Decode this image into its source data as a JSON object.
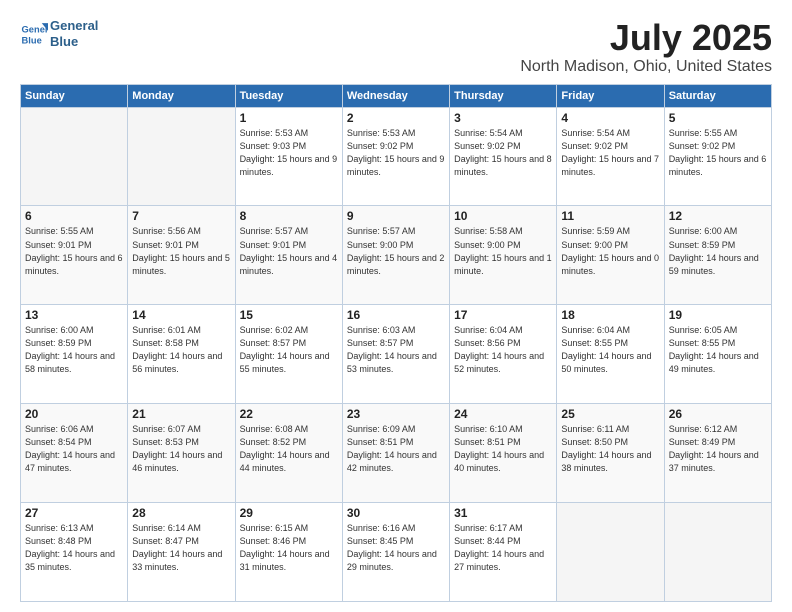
{
  "header": {
    "logo_line1": "General",
    "logo_line2": "Blue",
    "title": "July 2025",
    "subtitle": "North Madison, Ohio, United States"
  },
  "calendar": {
    "days_of_week": [
      "Sunday",
      "Monday",
      "Tuesday",
      "Wednesday",
      "Thursday",
      "Friday",
      "Saturday"
    ],
    "weeks": [
      [
        {
          "num": "",
          "info": "",
          "empty": true
        },
        {
          "num": "",
          "info": "",
          "empty": true
        },
        {
          "num": "1",
          "info": "Sunrise: 5:53 AM\nSunset: 9:03 PM\nDaylight: 15 hours and 9 minutes."
        },
        {
          "num": "2",
          "info": "Sunrise: 5:53 AM\nSunset: 9:02 PM\nDaylight: 15 hours and 9 minutes."
        },
        {
          "num": "3",
          "info": "Sunrise: 5:54 AM\nSunset: 9:02 PM\nDaylight: 15 hours and 8 minutes."
        },
        {
          "num": "4",
          "info": "Sunrise: 5:54 AM\nSunset: 9:02 PM\nDaylight: 15 hours and 7 minutes."
        },
        {
          "num": "5",
          "info": "Sunrise: 5:55 AM\nSunset: 9:02 PM\nDaylight: 15 hours and 6 minutes."
        }
      ],
      [
        {
          "num": "6",
          "info": "Sunrise: 5:55 AM\nSunset: 9:01 PM\nDaylight: 15 hours and 6 minutes."
        },
        {
          "num": "7",
          "info": "Sunrise: 5:56 AM\nSunset: 9:01 PM\nDaylight: 15 hours and 5 minutes."
        },
        {
          "num": "8",
          "info": "Sunrise: 5:57 AM\nSunset: 9:01 PM\nDaylight: 15 hours and 4 minutes."
        },
        {
          "num": "9",
          "info": "Sunrise: 5:57 AM\nSunset: 9:00 PM\nDaylight: 15 hours and 2 minutes."
        },
        {
          "num": "10",
          "info": "Sunrise: 5:58 AM\nSunset: 9:00 PM\nDaylight: 15 hours and 1 minute."
        },
        {
          "num": "11",
          "info": "Sunrise: 5:59 AM\nSunset: 9:00 PM\nDaylight: 15 hours and 0 minutes."
        },
        {
          "num": "12",
          "info": "Sunrise: 6:00 AM\nSunset: 8:59 PM\nDaylight: 14 hours and 59 minutes."
        }
      ],
      [
        {
          "num": "13",
          "info": "Sunrise: 6:00 AM\nSunset: 8:59 PM\nDaylight: 14 hours and 58 minutes."
        },
        {
          "num": "14",
          "info": "Sunrise: 6:01 AM\nSunset: 8:58 PM\nDaylight: 14 hours and 56 minutes."
        },
        {
          "num": "15",
          "info": "Sunrise: 6:02 AM\nSunset: 8:57 PM\nDaylight: 14 hours and 55 minutes."
        },
        {
          "num": "16",
          "info": "Sunrise: 6:03 AM\nSunset: 8:57 PM\nDaylight: 14 hours and 53 minutes."
        },
        {
          "num": "17",
          "info": "Sunrise: 6:04 AM\nSunset: 8:56 PM\nDaylight: 14 hours and 52 minutes."
        },
        {
          "num": "18",
          "info": "Sunrise: 6:04 AM\nSunset: 8:55 PM\nDaylight: 14 hours and 50 minutes."
        },
        {
          "num": "19",
          "info": "Sunrise: 6:05 AM\nSunset: 8:55 PM\nDaylight: 14 hours and 49 minutes."
        }
      ],
      [
        {
          "num": "20",
          "info": "Sunrise: 6:06 AM\nSunset: 8:54 PM\nDaylight: 14 hours and 47 minutes."
        },
        {
          "num": "21",
          "info": "Sunrise: 6:07 AM\nSunset: 8:53 PM\nDaylight: 14 hours and 46 minutes."
        },
        {
          "num": "22",
          "info": "Sunrise: 6:08 AM\nSunset: 8:52 PM\nDaylight: 14 hours and 44 minutes."
        },
        {
          "num": "23",
          "info": "Sunrise: 6:09 AM\nSunset: 8:51 PM\nDaylight: 14 hours and 42 minutes."
        },
        {
          "num": "24",
          "info": "Sunrise: 6:10 AM\nSunset: 8:51 PM\nDaylight: 14 hours and 40 minutes."
        },
        {
          "num": "25",
          "info": "Sunrise: 6:11 AM\nSunset: 8:50 PM\nDaylight: 14 hours and 38 minutes."
        },
        {
          "num": "26",
          "info": "Sunrise: 6:12 AM\nSunset: 8:49 PM\nDaylight: 14 hours and 37 minutes."
        }
      ],
      [
        {
          "num": "27",
          "info": "Sunrise: 6:13 AM\nSunset: 8:48 PM\nDaylight: 14 hours and 35 minutes."
        },
        {
          "num": "28",
          "info": "Sunrise: 6:14 AM\nSunset: 8:47 PM\nDaylight: 14 hours and 33 minutes."
        },
        {
          "num": "29",
          "info": "Sunrise: 6:15 AM\nSunset: 8:46 PM\nDaylight: 14 hours and 31 minutes."
        },
        {
          "num": "30",
          "info": "Sunrise: 6:16 AM\nSunset: 8:45 PM\nDaylight: 14 hours and 29 minutes."
        },
        {
          "num": "31",
          "info": "Sunrise: 6:17 AM\nSunset: 8:44 PM\nDaylight: 14 hours and 27 minutes."
        },
        {
          "num": "",
          "info": "",
          "empty": true
        },
        {
          "num": "",
          "info": "",
          "empty": true
        }
      ]
    ]
  }
}
